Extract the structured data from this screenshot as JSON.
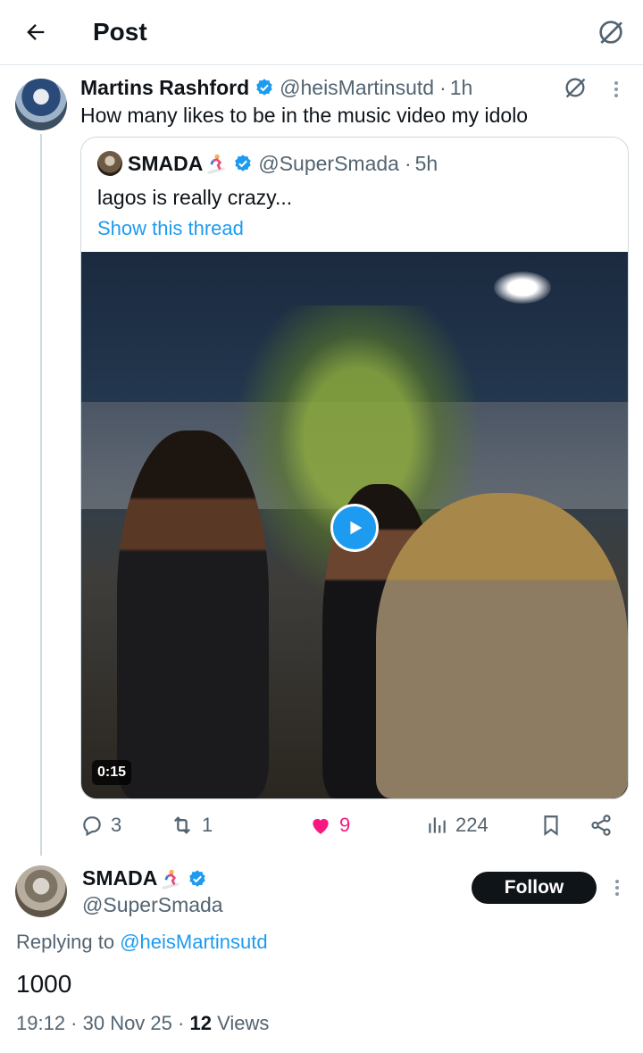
{
  "header": {
    "title": "Post"
  },
  "post": {
    "author_name": "Martins Rashford",
    "author_handle": "@heisMartinsutd",
    "time": "1h",
    "text": "How many likes to be in the music video my idolo"
  },
  "quoted": {
    "author_name": "SMADA",
    "author_handle": "@SuperSmada",
    "time": "5h",
    "text": "lagos is really crazy...",
    "show_thread_label": "Show this thread",
    "video_duration": "0:15"
  },
  "stats": {
    "replies": "3",
    "reposts": "1",
    "likes": "9",
    "views": "224"
  },
  "reply": {
    "author_name": "SMADA",
    "author_handle": "@SuperSmada",
    "follow_label": "Follow",
    "replying_prefix": "Replying to",
    "replying_handle": "@heisMartinsutd",
    "text": "1000",
    "timestamp": "19:12 · 30 Nov 25 · ",
    "views_count": "12",
    "views_label": "Views"
  },
  "colors": {
    "accent": "#1d9bf0",
    "like": "#f91880",
    "text_secondary": "#536471"
  },
  "icons": [
    "back-arrow-icon",
    "grok-icon",
    "verified-badge-icon",
    "snowboarder-emoji-icon",
    "play-icon",
    "reply-icon",
    "retweet-icon",
    "heart-icon",
    "views-icon",
    "bookmark-icon",
    "share-icon",
    "more-icon"
  ]
}
